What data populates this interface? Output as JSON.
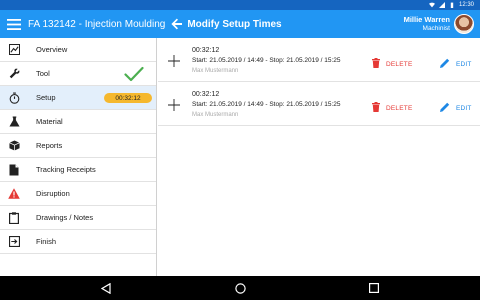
{
  "status_bar": {
    "time": "12:30",
    "icons": [
      "wifi-icon",
      "signal-icon",
      "battery-icon"
    ]
  },
  "app_bar": {
    "menu_icon": "hamburger-menu-icon",
    "app_title": "FA 132142 - Injection Moulding",
    "back_icon": "arrow-left-icon",
    "page_title": "Modify Setup Times",
    "user": {
      "name": "Millie Warren",
      "role": "Machinist"
    }
  },
  "sidebar": {
    "items": [
      {
        "label": "Overview",
        "icon": "chart-icon"
      },
      {
        "label": "Tool",
        "icon": "wrench-icon",
        "status_icon": "check-icon"
      },
      {
        "label": "Setup",
        "icon": "stopwatch-icon",
        "timer": "00:32:12"
      },
      {
        "label": "Material",
        "icon": "flask-icon"
      },
      {
        "label": "Reports",
        "icon": "cube-icon"
      },
      {
        "label": "Tracking Receipts",
        "icon": "document-icon"
      },
      {
        "label": "Disruption",
        "icon": "warning-icon"
      },
      {
        "label": "Drawings / Notes",
        "icon": "clipboard-icon"
      },
      {
        "label": "Finish",
        "icon": "exit-icon"
      }
    ],
    "active_index": 2
  },
  "setup_times": [
    {
      "duration": "00:32:12",
      "range": "Start: 21.05.2019 / 14:49 - Stop: 21.05.2019 / 15:25",
      "user": "Max Mustermann",
      "delete_label": "DELETE",
      "edit_label": "EDIT"
    },
    {
      "duration": "00:32:12",
      "range": "Start: 21.05.2019 / 14:49 - Stop: 21.05.2019 / 15:25",
      "user": "Max Mustermann",
      "delete_label": "DELETE",
      "edit_label": "EDIT"
    }
  ],
  "colors": {
    "app_bar": "#2196f3",
    "status_bar": "#1565c0",
    "active_item": "#e3effb",
    "timer_badge": "#f5b82e",
    "check": "#4caf50",
    "delete": "#e53935",
    "edit": "#1e88e5"
  }
}
